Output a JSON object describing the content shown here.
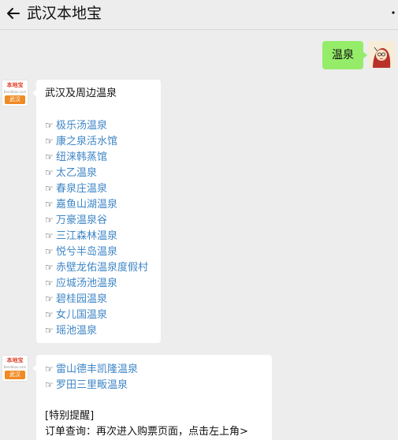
{
  "header": {
    "title": "武汉本地宝",
    "back_icon": "arrow-left-icon",
    "more_icon": "more-dots-icon"
  },
  "outgoing": {
    "text": "温泉",
    "bubble_color": "#95ec69"
  },
  "bot_avatar": {
    "logo_text": "本地宝",
    "logo_sub": "Bendibao.com",
    "city_tag": "武汉",
    "accent": "#f08a24"
  },
  "message1": {
    "heading": "武汉及周边温泉",
    "hand_icon": "☞",
    "items": [
      "极乐汤温泉",
      "康之泉活水馆",
      "纽涞韩蒸馆",
      "太乙温泉",
      "春泉庄温泉",
      "嘉鱼山湖温泉",
      "万豪温泉谷",
      "三江森林温泉",
      "悦兮半岛温泉",
      "赤壁龙佑温泉度假村",
      "应城汤池温泉",
      "碧桂园温泉",
      "女儿国温泉",
      "瑶池温泉"
    ]
  },
  "message2": {
    "hand_icon": "☞",
    "items": [
      "雷山德丰凯隆温泉",
      "罗田三里畈温泉"
    ],
    "notice_title": "[特别提醒]",
    "notice_line": "订单查询：再次进入购票页面，点击左上角>"
  },
  "colors": {
    "link": "#3f86c6",
    "background": "#ededed"
  }
}
